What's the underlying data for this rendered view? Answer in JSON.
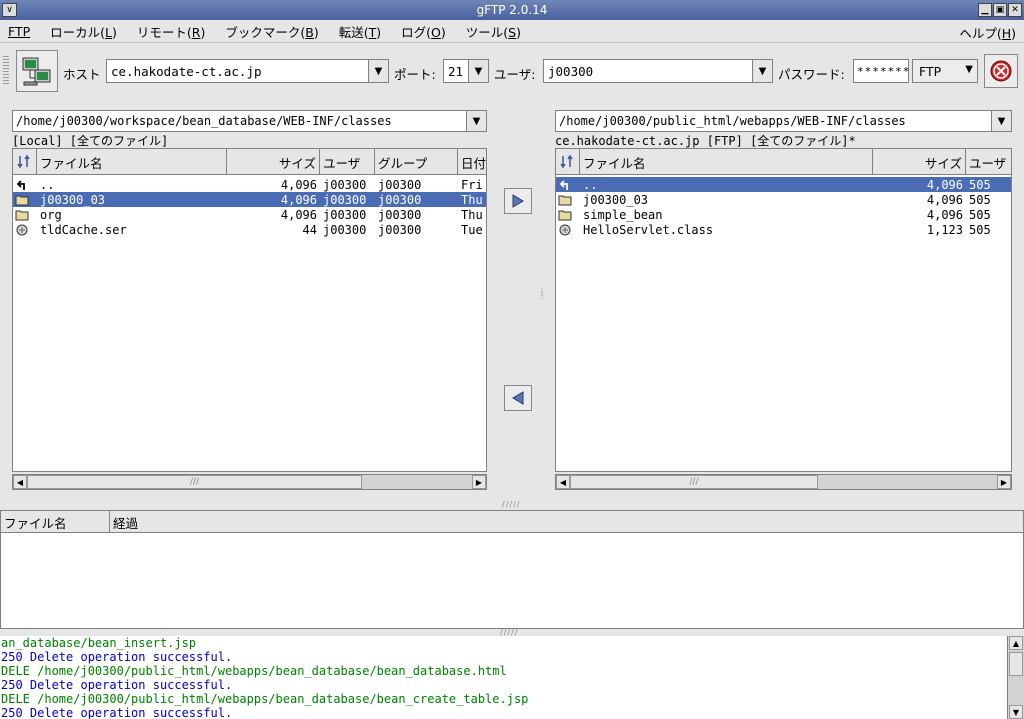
{
  "window": {
    "title": "gFTP 2.0.14"
  },
  "menu": [
    {
      "label": "FTP",
      "key": ""
    },
    {
      "label": "ローカル(",
      "key": "L",
      "end": ")"
    },
    {
      "label": "リモート(",
      "key": "R",
      "end": ")"
    },
    {
      "label": "ブックマーク(",
      "key": "B",
      "end": ")"
    },
    {
      "label": "転送(",
      "key": "T",
      "end": ")"
    },
    {
      "label": "ログ(",
      "key": "O",
      "end": ")"
    },
    {
      "label": "ツール(",
      "key": "S",
      "end": ")"
    }
  ],
  "menu_help": {
    "label": "ヘルプ(",
    "key": "H",
    "end": ")"
  },
  "toolbar": {
    "host_label": "ホスト",
    "host_value": "ce.hakodate-ct.ac.jp",
    "port_label": "ポート:",
    "port_value": "21",
    "user_label": "ユーザ:",
    "user_value": "j00300",
    "password_label": "パスワード:",
    "password_value": "*******",
    "protocol": "FTP"
  },
  "local": {
    "path": "/home/j00300/workspace/bean_database/WEB-INF/classes",
    "status": "[Local] [全てのファイル]",
    "columns": {
      "name": "ファイル名",
      "size": "サイズ",
      "user": "ユーザ",
      "group": "グループ",
      "date": "日付"
    },
    "files": [
      {
        "icon": "up-dir-icon",
        "name": "..",
        "size": "4,096",
        "user": "j00300",
        "group": "j00300",
        "date": "Fri",
        "selected": false
      },
      {
        "icon": "folder-icon",
        "name": "j00300_03",
        "size": "4,096",
        "user": "j00300",
        "group": "j00300",
        "date": "Thu",
        "selected": true
      },
      {
        "icon": "folder-icon",
        "name": "org",
        "size": "4,096",
        "user": "j00300",
        "group": "j00300",
        "date": "Thu",
        "selected": false
      },
      {
        "icon": "file-icon",
        "name": "tldCache.ser",
        "size": "44",
        "user": "j00300",
        "group": "j00300",
        "date": "Tue",
        "selected": false
      }
    ]
  },
  "remote": {
    "path": "/home/j00300/public_html/webapps/WEB-INF/classes",
    "status": "ce.hakodate-ct.ac.jp [FTP] [全てのファイル]*",
    "columns": {
      "name": "ファイル名",
      "size": "サイズ",
      "user": "ユーザ"
    },
    "files": [
      {
        "icon": "up-dir-icon",
        "name": "..",
        "size": "4,096",
        "user": "505",
        "selected": true
      },
      {
        "icon": "folder-icon",
        "name": "j00300_03",
        "size": "4,096",
        "user": "505",
        "selected": false
      },
      {
        "icon": "folder-icon",
        "name": "simple_bean",
        "size": "4,096",
        "user": "505",
        "selected": false
      },
      {
        "icon": "file-icon",
        "name": "HelloServlet.class",
        "size": "1,123",
        "user": "505",
        "selected": false
      }
    ]
  },
  "queue": {
    "columns": {
      "filename": "ファイル名",
      "progress": "経過"
    }
  },
  "log": [
    {
      "text": "an_database/bean_insert.jsp",
      "color": "#008000"
    },
    {
      "text": "250 Delete operation successful.",
      "color": "#0000c0"
    },
    {
      "text": "DELE /home/j00300/public_html/webapps/bean_database/bean_database.html",
      "color": "#008000"
    },
    {
      "text": "250 Delete operation successful.",
      "color": "#0000c0"
    },
    {
      "text": "DELE /home/j00300/public_html/webapps/bean_database/bean_create_table.jsp",
      "color": "#008000"
    },
    {
      "text": "250 Delete operation successful.",
      "color": "#0000c0"
    }
  ],
  "colors": {
    "selection": "#4a6cb5",
    "log_command": "#008000",
    "log_response": "#0000c0"
  }
}
